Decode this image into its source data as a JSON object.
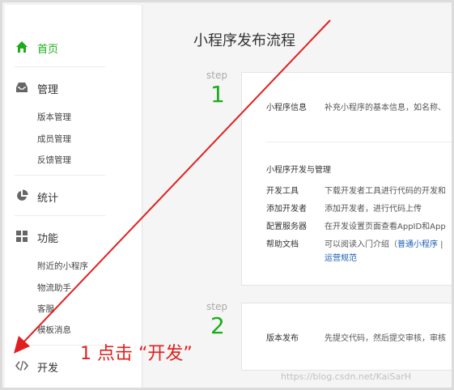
{
  "page": {
    "title": "小程序发布流程"
  },
  "sidebar": {
    "home": {
      "label": "首页",
      "icon": "home-icon",
      "active": true
    },
    "manage": {
      "label": "管理",
      "icon": "inbox-icon",
      "items": [
        "版本管理",
        "成员管理",
        "反馈管理"
      ]
    },
    "stats": {
      "label": "统计",
      "icon": "pie-chart-icon"
    },
    "features": {
      "label": "功能",
      "icon": "grid-icon",
      "items": [
        "附近的小程序",
        "物流助手",
        "客服",
        "模板消息"
      ]
    },
    "dev": {
      "label": "开发",
      "icon": "code-icon"
    }
  },
  "steps": [
    {
      "word": "step",
      "number": "1",
      "info_key": "小程序信息",
      "info_value": "补充小程序的基本信息，如名称、",
      "section_title": "小程序开发与管理",
      "rows": [
        {
          "key": "开发工具",
          "value": "下载开发者工具进行代码的开发和"
        },
        {
          "key": "添加开发者",
          "value": "添加开发者，进行代码上传"
        },
        {
          "key": "配置服务器",
          "value": "在开发设置页面查看AppID和App"
        },
        {
          "key": "帮助文档",
          "value": "可以阅读入门介绍（",
          "link1": "普通小程序",
          "sep": " | ",
          "link2": "运营规范"
        }
      ]
    },
    {
      "word": "step",
      "number": "2",
      "info_key": "版本发布",
      "info_value": "先提交代码，然后提交审核，审核"
    }
  ],
  "annotation": "1 点击 “开发”",
  "watermark": "https://blog.csdn.net/KaiSarH",
  "colors": {
    "accent": "#1aad19",
    "annotation": "#e02020",
    "link": "#1a5fb4"
  }
}
